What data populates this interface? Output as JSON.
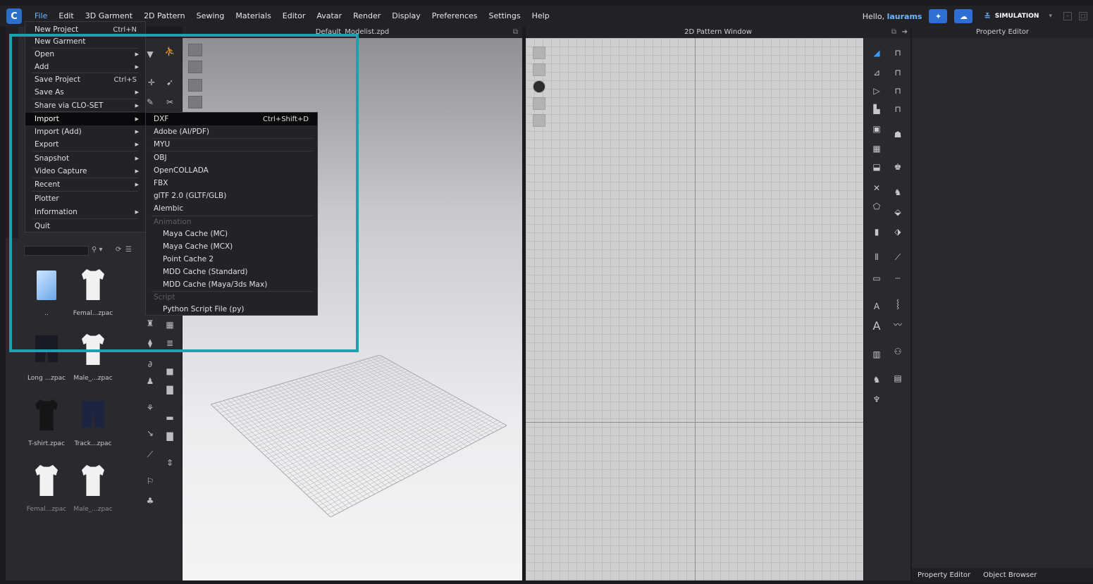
{
  "app": {
    "logo_glyph": "C"
  },
  "menubar": {
    "items": [
      "File",
      "Edit",
      "3D Garment",
      "2D Pattern",
      "Sewing",
      "Materials",
      "Editor",
      "Avatar",
      "Render",
      "Display",
      "Preferences",
      "Settings",
      "Help"
    ],
    "greeting_prefix": "Hello, ",
    "username": "laurams",
    "mode_label": "SIMULATION"
  },
  "panels": {
    "viewport_title": "Default_Modelist.zpd",
    "pattern_title": "2D Pattern Window",
    "property_title": "Property Editor"
  },
  "file_menu": [
    {
      "label": "New Project",
      "shortcut": "Ctrl+N",
      "submenu": false
    },
    {
      "label": "New Garment",
      "shortcut": "",
      "submenu": false
    },
    {
      "label": "Open",
      "shortcut": "",
      "submenu": true
    },
    {
      "label": "Add",
      "shortcut": "",
      "submenu": true
    },
    {
      "label": "Save Project",
      "shortcut": "Ctrl+S",
      "submenu": false
    },
    {
      "label": "Save As",
      "shortcut": "",
      "submenu": true
    },
    {
      "label": "Share via CLO-SET",
      "shortcut": "",
      "submenu": true
    },
    {
      "label": "Import",
      "shortcut": "",
      "submenu": true
    },
    {
      "label": "Import (Add)",
      "shortcut": "",
      "submenu": true
    },
    {
      "label": "Export",
      "shortcut": "",
      "submenu": true
    },
    {
      "label": "Snapshot",
      "shortcut": "",
      "submenu": true
    },
    {
      "label": "Video Capture",
      "shortcut": "",
      "submenu": true
    },
    {
      "label": "Recent",
      "shortcut": "",
      "submenu": true
    },
    {
      "label": "Plotter",
      "shortcut": "",
      "submenu": false
    },
    {
      "label": "Information",
      "shortcut": "",
      "submenu": true
    },
    {
      "label": "Quit",
      "shortcut": "",
      "submenu": false
    }
  ],
  "import_menu": [
    {
      "label": "DXF",
      "shortcut": "Ctrl+Shift+D"
    },
    {
      "label": "Adobe (AI/PDF)",
      "shortcut": ""
    },
    {
      "label": "MYU",
      "shortcut": ""
    },
    {
      "label": "OBJ",
      "shortcut": ""
    },
    {
      "label": "OpenCOLLADA",
      "shortcut": ""
    },
    {
      "label": "FBX",
      "shortcut": ""
    },
    {
      "label": "glTF 2.0 (GLTF/GLB)",
      "shortcut": ""
    },
    {
      "label": "Alembic",
      "shortcut": ""
    },
    {
      "label": "Animation",
      "shortcut": ""
    },
    {
      "label": "Maya Cache (MC)",
      "shortcut": ""
    },
    {
      "label": "Maya Cache (MCX)",
      "shortcut": ""
    },
    {
      "label": "Point Cache 2",
      "shortcut": ""
    },
    {
      "label": "MDD Cache (Standard)",
      "shortcut": ""
    },
    {
      "label": "MDD Cache (Maya/3ds Max)",
      "shortcut": ""
    },
    {
      "label": "Script",
      "shortcut": ""
    },
    {
      "label": "Python Script File (py)",
      "shortcut": ""
    }
  ],
  "library": {
    "thumbnails": [
      {
        "caption": "..",
        "icon": "folder"
      },
      {
        "caption": "Femal...zpac",
        "icon": "tshirt-white"
      },
      {
        "caption": "Long ...zpac",
        "icon": "shorts-dark"
      },
      {
        "caption": "Male_...zpac",
        "icon": "tshirt-white"
      },
      {
        "caption": "T-shirt.zpac",
        "icon": "tshirt-dark"
      },
      {
        "caption": "Track...zpac",
        "icon": "shorts-dark"
      },
      {
        "caption": "Femal...zpac",
        "icon": "tshirt-white"
      },
      {
        "caption": "Male_...zpac",
        "icon": "tshirt-white"
      }
    ]
  },
  "property_tabs": [
    "Property Editor",
    "Object Browser"
  ],
  "colors": {
    "highlight": "#18a3b0",
    "accent": "#2d6fd2"
  }
}
